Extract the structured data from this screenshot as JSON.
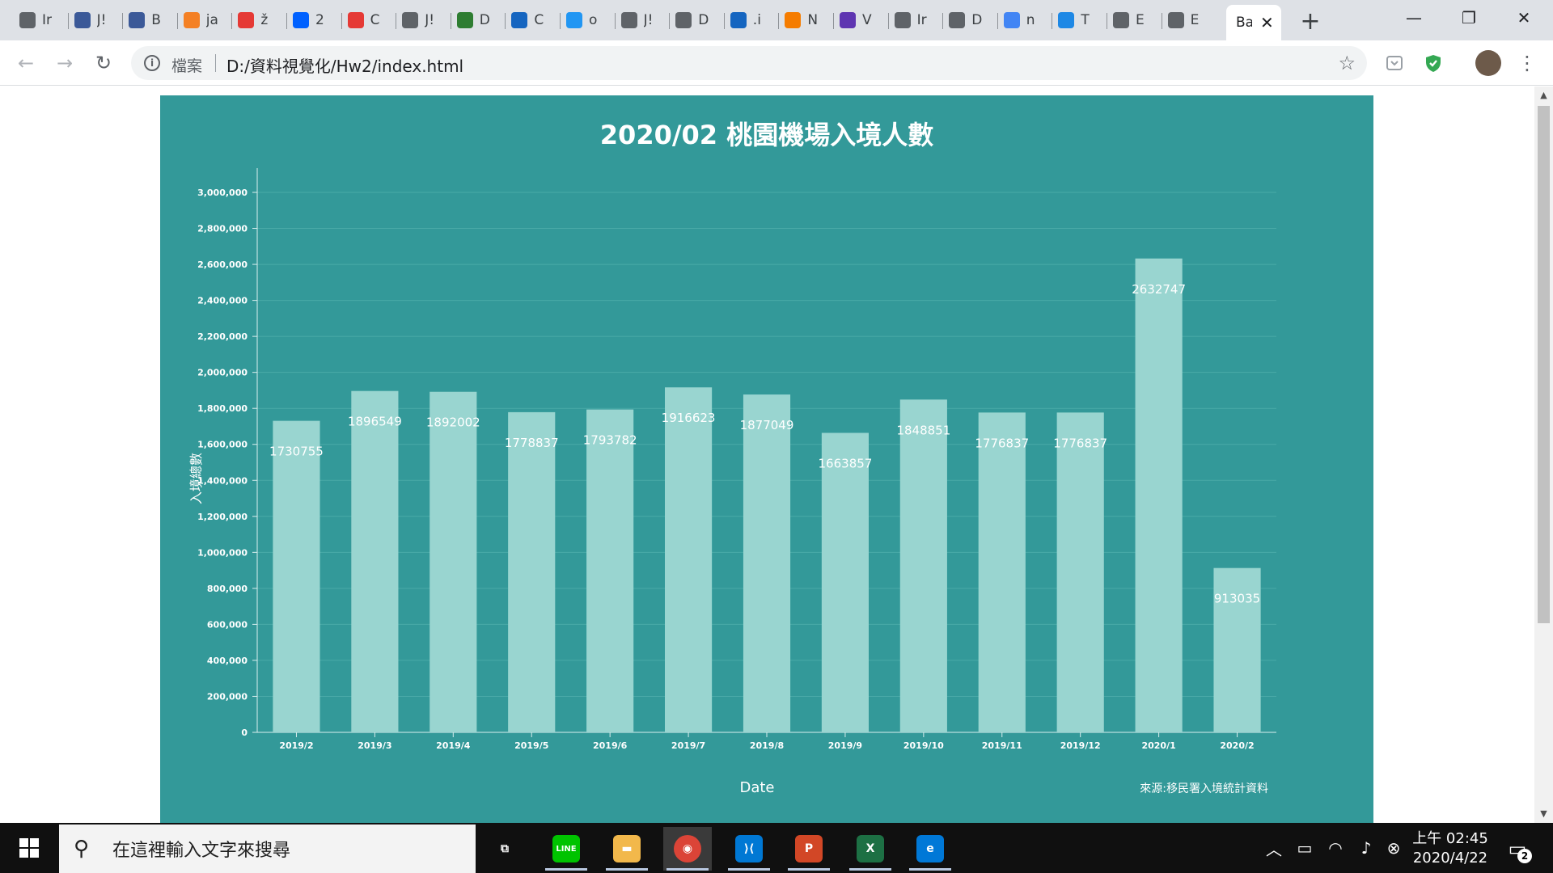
{
  "browser": {
    "tabs": [
      {
        "title": "Ir",
        "icon": "chrome-circle-icon",
        "color": "#5f6368"
      },
      {
        "title": "J!",
        "icon": "calculator-icon",
        "color": "#3b5998"
      },
      {
        "title": "B",
        "icon": "calculator-icon",
        "color": "#3b5998"
      },
      {
        "title": "ja",
        "icon": "stackoverflow-icon",
        "color": "#f48024"
      },
      {
        "title": "ž",
        "icon": "heart-gem-icon",
        "color": "#e53935"
      },
      {
        "title": "2",
        "icon": "dropbox-icon",
        "color": "#0061ff"
      },
      {
        "title": "C",
        "icon": "bar-chart-icon",
        "color": "#e53935"
      },
      {
        "title": "J!",
        "icon": "globe-icon",
        "color": "#5f6368"
      },
      {
        "title": "D",
        "icon": "layers-icon",
        "color": "#2e7d32"
      },
      {
        "title": "C",
        "icon": "typora-icon",
        "color": "#1565c0"
      },
      {
        "title": "o",
        "icon": "cap-icon",
        "color": "#2196f3"
      },
      {
        "title": "J!",
        "icon": "globe-icon",
        "color": "#5f6368"
      },
      {
        "title": "D",
        "icon": "globe-icon",
        "color": "#5f6368"
      },
      {
        "title": ".i",
        "icon": "jupyter-icon",
        "color": "#1565c0"
      },
      {
        "title": "N",
        "icon": "clock-orange-icon",
        "color": "#f57c00"
      },
      {
        "title": "V",
        "icon": "list-icon",
        "color": "#5e35b1"
      },
      {
        "title": "Ir",
        "icon": "globe-icon",
        "color": "#5f6368"
      },
      {
        "title": "D",
        "icon": "globe-icon",
        "color": "#5f6368"
      },
      {
        "title": "n",
        "icon": "google-icon",
        "color": "#4285f4"
      },
      {
        "title": "T",
        "icon": "download-icon",
        "color": "#1e88e5"
      },
      {
        "title": "E",
        "icon": "globe-icon",
        "color": "#5f6368"
      },
      {
        "title": "E",
        "icon": "globe-icon",
        "color": "#5f6368"
      }
    ],
    "active_tab": {
      "title": "Ba",
      "close": "✕"
    },
    "new_tab": "+",
    "window_controls": {
      "minimize": "—",
      "restore": "❐",
      "close": "✕"
    },
    "toolbar": {
      "back": "←",
      "forward": "→",
      "reload": "↻",
      "info": "i",
      "scheme_label": "檔案",
      "url": "D:/資料視覺化/Hw2/index.html",
      "star": "☆",
      "menu": "⋮"
    }
  },
  "chart_data": {
    "type": "bar",
    "title": "2020/02 桃園機場入境人數",
    "xlabel": "Date",
    "ylabel": "入境總數",
    "source_note": "來源:移民署入境統計資料",
    "categories": [
      "2019/2",
      "2019/3",
      "2019/4",
      "2019/5",
      "2019/6",
      "2019/7",
      "2019/8",
      "2019/9",
      "2019/10",
      "2019/11",
      "2019/12",
      "2020/1",
      "2020/2"
    ],
    "values": [
      1730755,
      1896549,
      1892002,
      1778837,
      1793782,
      1916623,
      1877049,
      1663857,
      1848851,
      1776837,
      1776837,
      2632747,
      913035
    ],
    "ylim": [
      0,
      3000000
    ],
    "yticks": [
      "0",
      "200,000",
      "400,000",
      "600,000",
      "800,000",
      "1,000,000",
      "1,200,000",
      "1,400,000",
      "1,600,000",
      "1,800,000",
      "2,000,000",
      "2,200,000",
      "2,400,000",
      "2,600,000",
      "2,800,000",
      "3,000,000"
    ],
    "grid": true,
    "colors": {
      "background": "#339999",
      "bar": "#99d5d0",
      "text": "#ffffff"
    }
  },
  "taskbar": {
    "search_placeholder": "在這裡輸入文字來搜尋",
    "apps": [
      {
        "name": "task-view",
        "label": "⧉",
        "color": "#101010"
      },
      {
        "name": "line",
        "label": "LINE",
        "color": "#00c300"
      },
      {
        "name": "file-explorer",
        "label": "▬",
        "color": "#f2b84b"
      },
      {
        "name": "chrome",
        "label": "◉",
        "color": "#db4437"
      },
      {
        "name": "vscode",
        "label": "⟩⟨",
        "color": "#0078d4"
      },
      {
        "name": "powerpoint",
        "label": "P",
        "color": "#d24726"
      },
      {
        "name": "excel",
        "label": "X",
        "color": "#1d7044"
      },
      {
        "name": "edge",
        "label": "e",
        "color": "#0078d7"
      }
    ],
    "clock_time": "上午 02:45",
    "clock_date": "2020/4/22",
    "notification_count": "2"
  }
}
